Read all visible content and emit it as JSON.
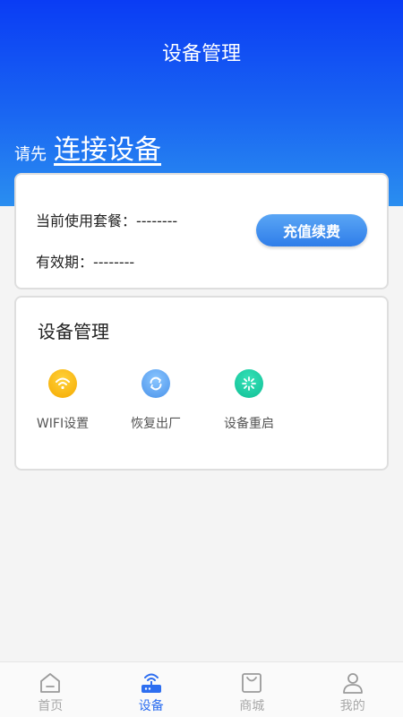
{
  "header": {
    "title": "设备管理",
    "prompt_prefix": "请先",
    "prompt_link": "连接设备"
  },
  "plan": {
    "current_plan_label": "当前使用套餐：--------",
    "validity_label": "有效期：--------",
    "recharge_button": "充值续费"
  },
  "device_management": {
    "title": "设备管理",
    "items": [
      {
        "label": "WIFI设置",
        "icon": "wifi-icon",
        "color": "#f7b500"
      },
      {
        "label": "恢复出厂",
        "icon": "refresh-icon",
        "color": "#4c9ff0"
      },
      {
        "label": "设备重启",
        "icon": "restart-icon",
        "color": "#17c8a0"
      }
    ]
  },
  "tabbar": {
    "items": [
      {
        "label": "首页",
        "icon": "home-icon",
        "active": false
      },
      {
        "label": "设备",
        "icon": "router-icon",
        "active": true
      },
      {
        "label": "商城",
        "icon": "shopping-bag-icon",
        "active": false
      },
      {
        "label": "我的",
        "icon": "user-icon",
        "active": false
      }
    ]
  },
  "colors": {
    "primary": "#2d6ef0",
    "header_top": "#0a3cf4",
    "background": "#f4f4f4"
  }
}
